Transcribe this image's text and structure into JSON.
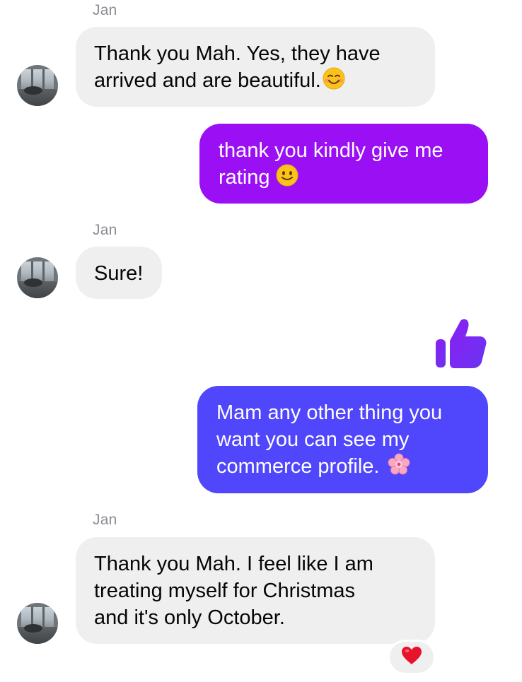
{
  "thread": {
    "messages": [
      {
        "direction": "incoming",
        "sender": "Jan",
        "text": "Thank you Mah. Yes, they have\narrived and are beautiful.",
        "emoji": "smiling-blush-emoji"
      },
      {
        "direction": "outgoing",
        "text": "thank you kindly give me\nrating",
        "emoji": "slightly-smiling-emoji"
      },
      {
        "direction": "incoming",
        "sender": "Jan",
        "text": "Sure!"
      },
      {
        "direction": "outgoing",
        "type": "like",
        "icon": "thumbs-up-icon"
      },
      {
        "direction": "outgoing",
        "text": "Mam any other thing you\nwant you can see my\ncommerce profile.",
        "emoji": "cherry-blossom-emoji"
      },
      {
        "direction": "incoming",
        "sender": "Jan",
        "text": "Thank you Mah. I feel like I am\ntreating myself for Christmas\nand it's only October.",
        "reaction": "red-heart-icon"
      }
    ]
  },
  "colors": {
    "incoming_bubble": "#efefef",
    "outgoing_bubble_1": "#9b0ff5",
    "outgoing_bubble_2": "#5046fb",
    "like_icon": "#7b2ff2",
    "sender_name": "#8a8d91",
    "heart": "#e8132a"
  }
}
